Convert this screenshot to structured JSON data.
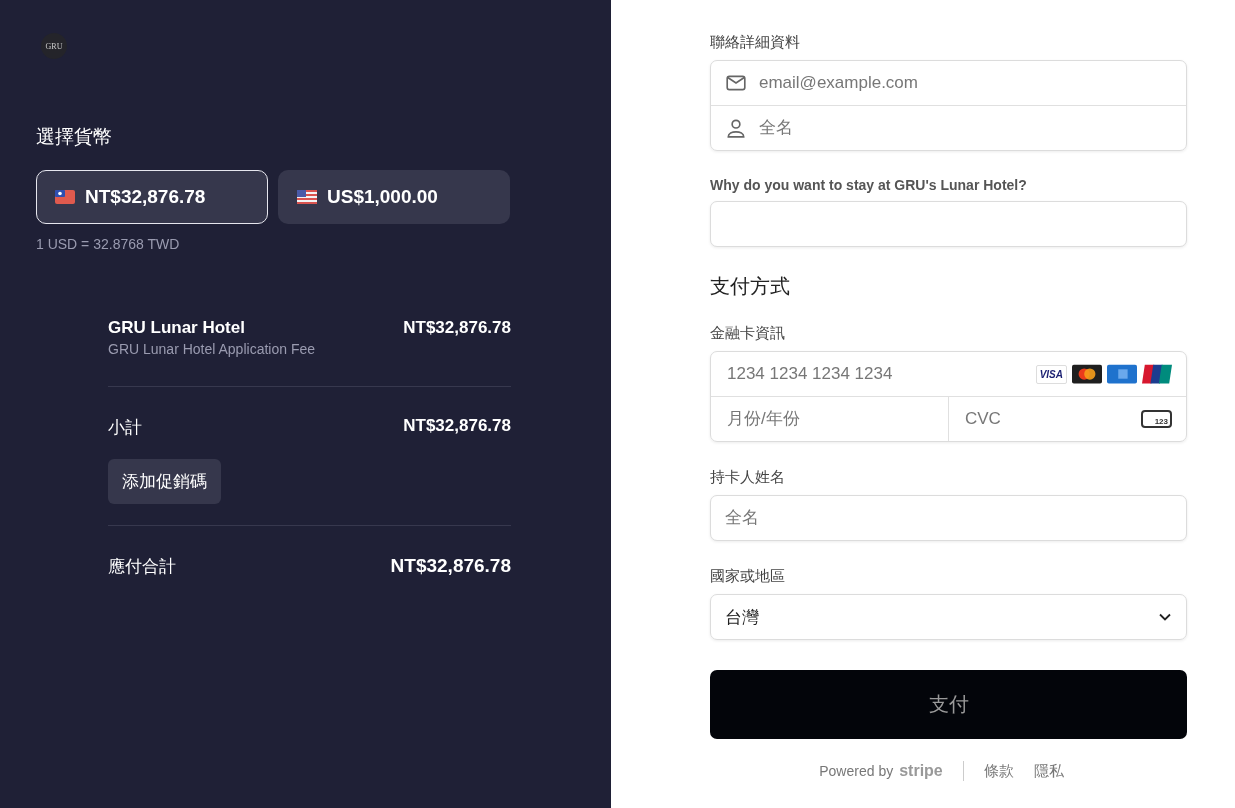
{
  "brand": {
    "logo": "GRU"
  },
  "currency": {
    "title": "選擇貨幣",
    "options": [
      {
        "label": "NT$32,876.78",
        "kind": "tw",
        "selected": true
      },
      {
        "label": "US$1,000.00",
        "kind": "us",
        "selected": false
      }
    ],
    "rate": "1 USD = 32.8768 TWD"
  },
  "order": {
    "item": {
      "name": "GRU Lunar Hotel",
      "description": "GRU Lunar Hotel Application Fee",
      "price": "NT$32,876.78"
    },
    "subtotal": {
      "label": "小計",
      "amount": "NT$32,876.78"
    },
    "promo_button": "添加促銷碼",
    "total": {
      "label": "應付合計",
      "amount": "NT$32,876.78"
    }
  },
  "contact": {
    "title": "聯絡詳細資料",
    "email_placeholder": "email@example.com",
    "name_placeholder": "全名"
  },
  "question": {
    "label": "Why do you want to stay at GRU's Lunar Hotel?"
  },
  "payment": {
    "title": "支付方式",
    "card_label": "金融卡資訊",
    "number_placeholder": "1234 1234 1234 1234",
    "visa": "VISA",
    "expiry_placeholder": "月份/年份",
    "cvc_placeholder": "CVC",
    "cvc_icon_text": "123"
  },
  "cardholder": {
    "label": "持卡人姓名",
    "placeholder": "全名"
  },
  "country": {
    "label": "國家或地區",
    "value": "台灣"
  },
  "pay_button": "支付",
  "footer": {
    "powered": "Powered by",
    "stripe": "stripe",
    "links": [
      "條款",
      "隱私"
    ]
  }
}
